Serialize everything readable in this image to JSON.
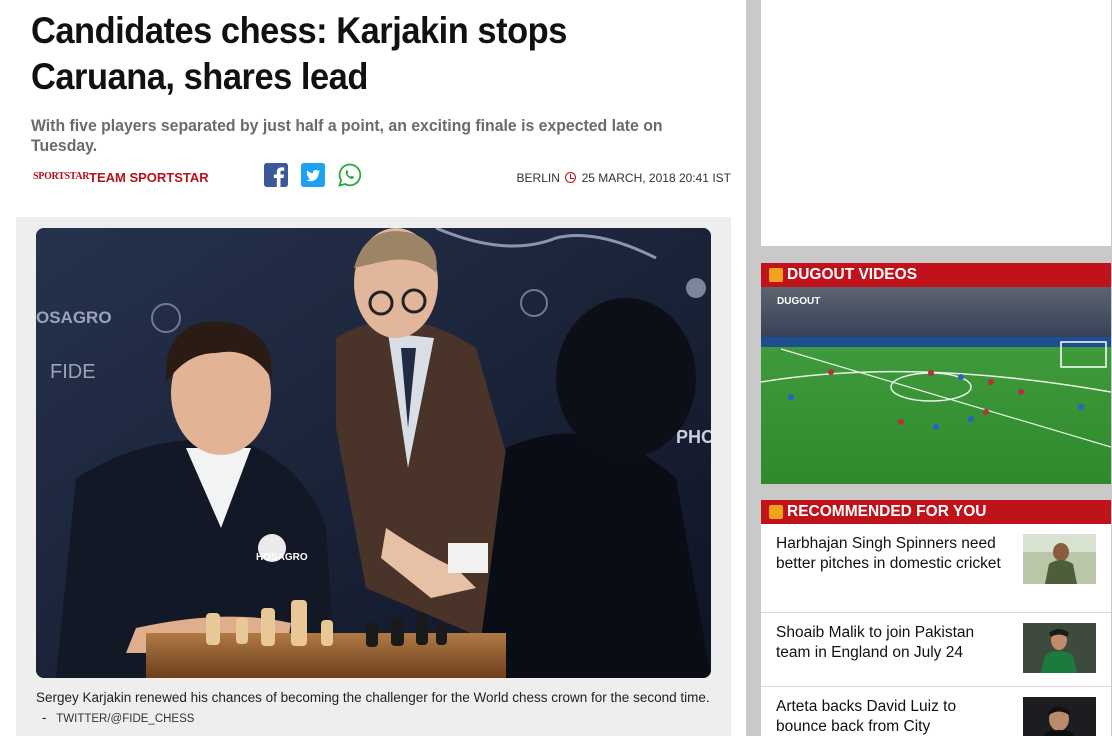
{
  "article": {
    "headline": "Candidates chess: Karjakin stops Caruana, shares lead",
    "standfirst": "With five players separated by just half a point, an exciting finale is expected late on Tuesday.",
    "publisher_logo": "SPORTSTAR",
    "author": "TEAM SPORTSTAR",
    "location": "BERLIN",
    "datetime": "25 MARCH, 2018 20:41 IST",
    "share_icons": [
      "facebook-icon",
      "twitter-icon",
      "whatsapp-icon"
    ],
    "caption": "Sergey Karjakin renewed his chances of becoming the challenger for the World chess crown for the second time.",
    "caption_separator": "-",
    "photo_credit": "TWITTER/@FIDE_CHESS",
    "photo_sponsor_text": [
      "OSAGRO",
      "FIDE",
      "HOSAGRO",
      "PHO"
    ]
  },
  "sidebar": {
    "videos": {
      "heading": "DUGOUT VIDEOS",
      "video_logo": "DUGOUT"
    },
    "recommended": {
      "heading": "RECOMMENDED FOR YOU",
      "items": [
        {
          "title": "Harbhajan Singh Spinners need better pitches in domestic cricket",
          "thumb": "cricketer-photo"
        },
        {
          "title": "Shoaib Malik to join Pakistan team in England on July 24",
          "thumb": "pakistan-player-photo"
        },
        {
          "title": "Arteta backs David Luiz to bounce back from City",
          "thumb": "arteta-photo"
        }
      ]
    }
  },
  "colors": {
    "brand_red": "#c0121b",
    "accent_orange": "#f3a21b",
    "text_dark": "#111111",
    "standfirst_gray": "#6b6b6b"
  }
}
